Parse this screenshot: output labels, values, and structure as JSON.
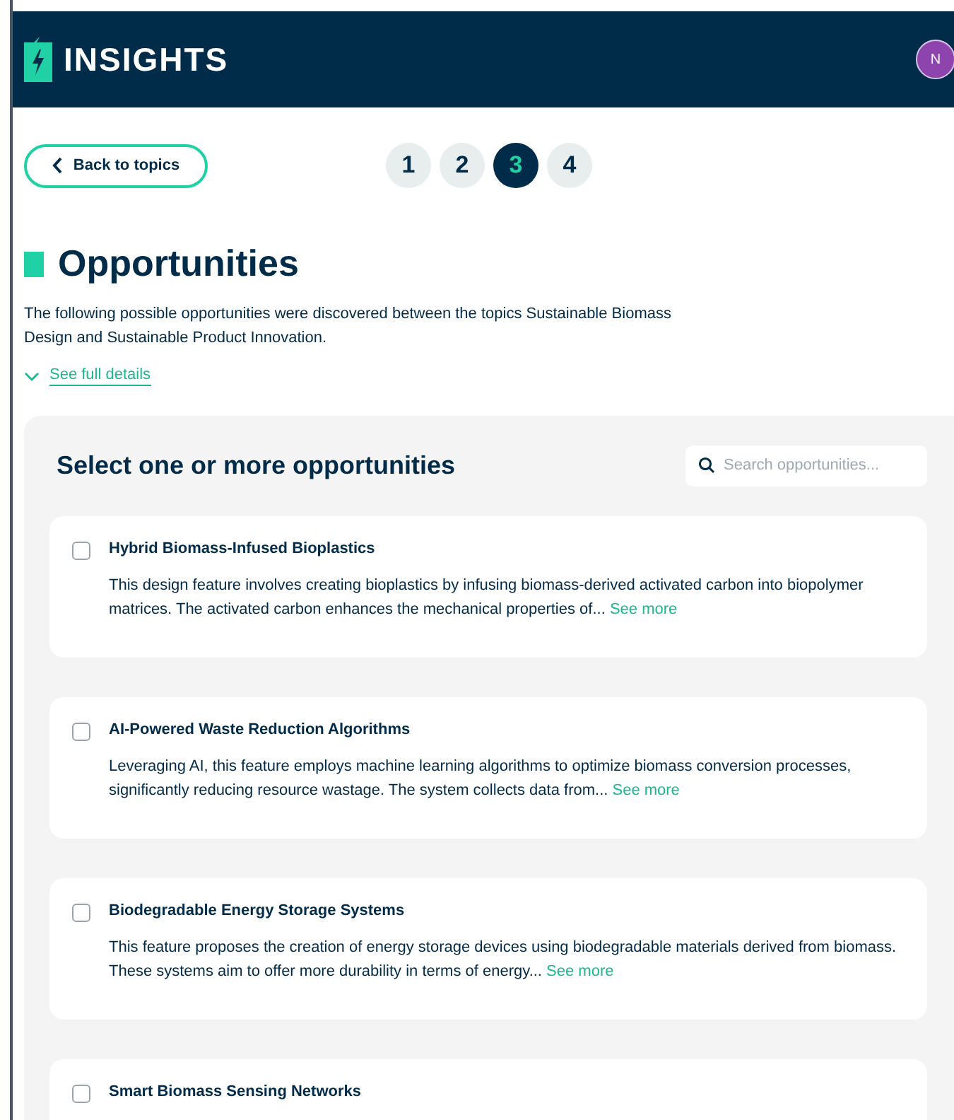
{
  "header": {
    "brand": "INSIGHTS",
    "avatar": "N"
  },
  "back_button": "Back to topics",
  "steps": [
    {
      "label": "1",
      "selected": false
    },
    {
      "label": "2",
      "selected": false
    },
    {
      "label": "3",
      "selected": true
    },
    {
      "label": "4",
      "selected": false
    }
  ],
  "title": "Opportunities",
  "intro": "The following possible opportunities were discovered between the topics Sustainable Biomass Design and Sustainable Product Innovation.",
  "details_link": "See full details",
  "panel": {
    "heading": "Select one or more opportunities",
    "search": {
      "placeholder": "Search opportunities..."
    },
    "items": [
      {
        "title": "Hybrid Biomass-Infused Bioplastics",
        "checked": false,
        "description": "This design feature involves creating bioplastics by infusing biomass-derived activated carbon into biopolymer matrices. The activated carbon enhances the mechanical properties of...",
        "link": "See more"
      },
      {
        "title": "AI-Powered Waste Reduction Algorithms",
        "checked": false,
        "description": "Leveraging AI, this feature employs machine learning algorithms to optimize biomass conversion processes, significantly reducing resource wastage. The system collects data from...",
        "link": "See more"
      },
      {
        "title": "Biodegradable Energy Storage Systems",
        "checked": false,
        "description": "This feature proposes the creation of energy storage devices using biodegradable materials derived from biomass. These systems aim to offer more durability in terms of energy...",
        "link": "See more"
      },
      {
        "title": "Smart Biomass Sensing Networks",
        "checked": false
      }
    ]
  }
}
